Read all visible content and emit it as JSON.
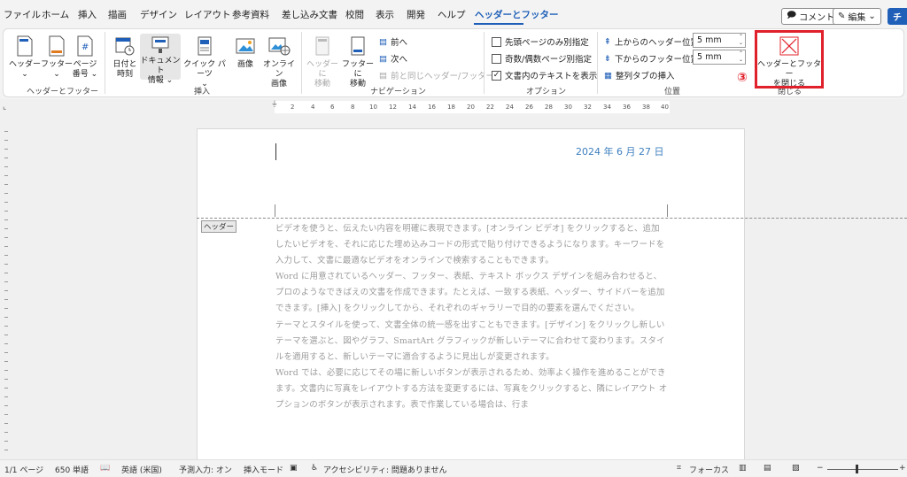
{
  "tabs": [
    "ファイル",
    "ホーム",
    "挿入",
    "描画",
    "デザイン",
    "レイアウト",
    "参考資料",
    "差し込み文書",
    "校閲",
    "表示",
    "開発",
    "ヘルプ",
    "ヘッダーとフッター"
  ],
  "top_right": {
    "comment_label": "コメント",
    "edit_label": "編集",
    "share_label": "チ"
  },
  "ribbon": {
    "groups": {
      "header_footer": "ヘッダーとフッター",
      "insert": "挿入",
      "navigation": "ナビゲーション",
      "options": "オプション",
      "position": "位置",
      "close": "閉じる"
    },
    "buttons": {
      "header": "ヘッダー\n⌄",
      "footer": "フッター\n⌄",
      "page_number": "ページ\n番号 ⌄",
      "date_time": "日付と\n時刻",
      "doc_info": "ドキュメント\n情報 ⌄",
      "quick_parts": "クイック パーツ\n⌄",
      "picture": "画像",
      "online_picture": "オンライン\n画像",
      "go_to_header": "ヘッダーに\n移動",
      "go_to_footer": "フッターに\n移動",
      "previous": "前へ",
      "next": "次へ",
      "link_to_previous": "前と同じヘッダー/フッター",
      "different_first_page": "先頭ページのみ別指定",
      "different_odd_even": "奇数/偶数ページ別指定",
      "show_document_text": "文書内のテキストを表示",
      "header_from_top": "上からのヘッダー位置:",
      "footer_from_bottom": "下からのフッター位置:",
      "header_value": "5 mm",
      "footer_value": "5 mm",
      "insert_alignment_tab": "整列タブの挿入",
      "close_header_footer": "ヘッダーとフッター\nを閉じる"
    },
    "step_marker": "③"
  },
  "ruler_numbers": [
    "2",
    "4",
    "6",
    "8",
    "10",
    "12",
    "14",
    "16",
    "18",
    "20",
    "22",
    "24",
    "26",
    "28",
    "30",
    "32",
    "34",
    "36",
    "38",
    "40"
  ],
  "document": {
    "date": "2024 年 6 月 27 日",
    "header_tag": "ヘッダー",
    "paragraphs": [
      "ビデオを使うと、伝えたい内容を明確に表現できます。[オンライン ビデオ] をクリックすると、追加したいビデオを、それに応じた埋め込みコードの形式で貼り付けできるようになります。キーワードを入力して、文書に最適なビデオをオンラインで検索することもできます。",
      "Word に用意されているヘッダー、フッター、表紙、テキスト ボックス デザインを組み合わせると、プロのようなできばえの文書を作成できます。たとえば、一致する表紙、ヘッダー、サイドバーを追加できます。[挿入] をクリックしてから、それぞれのギャラリーで目的の要素を選んでください。",
      "テーマとスタイルを使って、文書全体の統一感を出すこともできます。[デザイン] をクリックし新しいテーマを選ぶと、図やグラフ、SmartArt グラフィックが新しいテーマに合わせて変わります。スタイルを適用すると、新しいテーマに適合するように見出しが変更されます。",
      "Word では、必要に応じてその場に新しいボタンが表示されるため、効率よく操作を進めることができます。文書内に写真をレイアウトする方法を変更するには、写真をクリックすると、隣にレイアウト オプションのボタンが表示されます。表で作業している場合は、行ま"
    ]
  },
  "status": {
    "page": "1/1 ページ",
    "words": "650 単語",
    "language": "英語 (米国)",
    "predictive": "予測入力: オン",
    "insert_mode": "挿入モード",
    "accessibility": "アクセシビリティ: 問題ありません",
    "focus": "フォーカス",
    "zoom_minus": "−",
    "zoom_plus": "+"
  },
  "colors": {
    "accent": "#1f5fb8",
    "highlight_red": "#e0202a",
    "date_blue": "#3d7fbf"
  }
}
